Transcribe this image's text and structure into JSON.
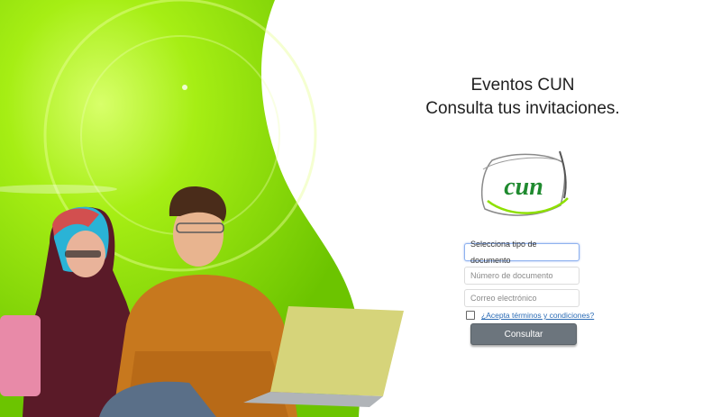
{
  "header": {
    "title_line1": "Eventos CUN",
    "title_line2": "Consulta tus invitaciones."
  },
  "logo": {
    "text": "cun"
  },
  "form": {
    "document_type_selected": "Selecciona tipo de documento",
    "document_number_placeholder": "Número de documento",
    "email_placeholder": "Correo electrónico",
    "terms_label": "¿Acepta términos y condiciones?",
    "terms_checked": false,
    "submit_label": "Consultar"
  },
  "colors": {
    "brand_green": "#8ee000",
    "link_blue": "#2a6bb5",
    "button_gray": "#6c757d"
  }
}
